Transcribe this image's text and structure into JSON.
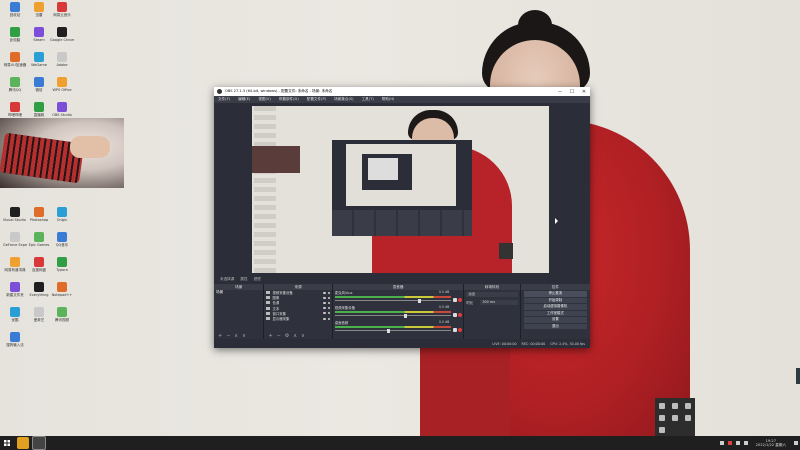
{
  "colors": {
    "taskbar": "#1f1f1f",
    "obs_bg": "#2b2e38",
    "obs_dock": "#2f323c",
    "sweater_red": "#b8232a",
    "meter_green": "#4cb04c",
    "mute_red": "#e03a3a"
  },
  "obs": {
    "title": "OBS 27.1.3 (64-bit, windows) - 配置文件: 未命名 - 场景: 未命名",
    "window_buttons": [
      "─",
      "☐",
      "✕"
    ],
    "menu": [
      "文件(F)",
      "编辑(E)",
      "视图(V)",
      "停靠部件(D)",
      "配置文件(P)",
      "场景集合(S)",
      "工具(T)",
      "帮助(H)"
    ],
    "below_preview": [
      "未选择源",
      "属性",
      "滤镜"
    ],
    "docks": {
      "scenes": {
        "header": "场景",
        "items": [
          "场景"
        ],
        "footer": [
          "+",
          "−",
          "∧",
          "∨"
        ]
      },
      "sources": {
        "header": "来源",
        "items": [
          "视频采集设备",
          "图像",
          "色源",
          "文本",
          "窗口采集",
          "显示器采集"
        ],
        "footer": [
          "+",
          "−",
          "⚙",
          "∧",
          "∨"
        ]
      },
      "mixer": {
        "header": "混音器",
        "channels": [
          {
            "name": "麦克风/Aux",
            "db": "0.0 dB",
            "level": 0.72
          },
          {
            "name": "视频采集设备",
            "db": "0.0 dB",
            "level": 0.6
          },
          {
            "name": "桌面音频",
            "db": "0.0 dB",
            "level": 0.45
          }
        ]
      },
      "transitions": {
        "header": "转场特效",
        "selected": "淡出",
        "duration_label": "时长",
        "duration_value": "300 ms"
      },
      "controls": {
        "header": "控件",
        "buttons": [
          "停止推流",
          "开始录制",
          "启动虚拟摄像机",
          "工作室模式",
          "设置",
          "退出"
        ]
      }
    },
    "status": [
      "LIVE: 00:00:00",
      "REC: 00:00:00",
      "CPU: 2.4%, 30.00 fps"
    ]
  },
  "desktop_icons": [
    "回收站",
    "迅雷",
    "网易云音乐",
    "此电脑",
    "Steam",
    "Google Chrome",
    "网易UU加速器",
    "WeGame",
    "Adobe",
    "腾讯QQ",
    "微信",
    "WPS Office",
    "哔哩哔哩",
    "直播姬",
    "OBS Studio",
    "Visual Studio Code",
    "Photoshop",
    "Origin",
    "GeForce Experience",
    "Epic Games",
    "QQ音乐",
    "网易有道词典",
    "百度网盘",
    "Typora",
    "新建文件夹",
    "Everything",
    "Notepad++",
    "优酷",
    "爱奇艺",
    "腾讯视频",
    "搜狗输入法"
  ],
  "taskbar": {
    "apps": [
      "obs-icon"
    ],
    "time": "19:27",
    "date": "2022/1/22 星期六"
  }
}
